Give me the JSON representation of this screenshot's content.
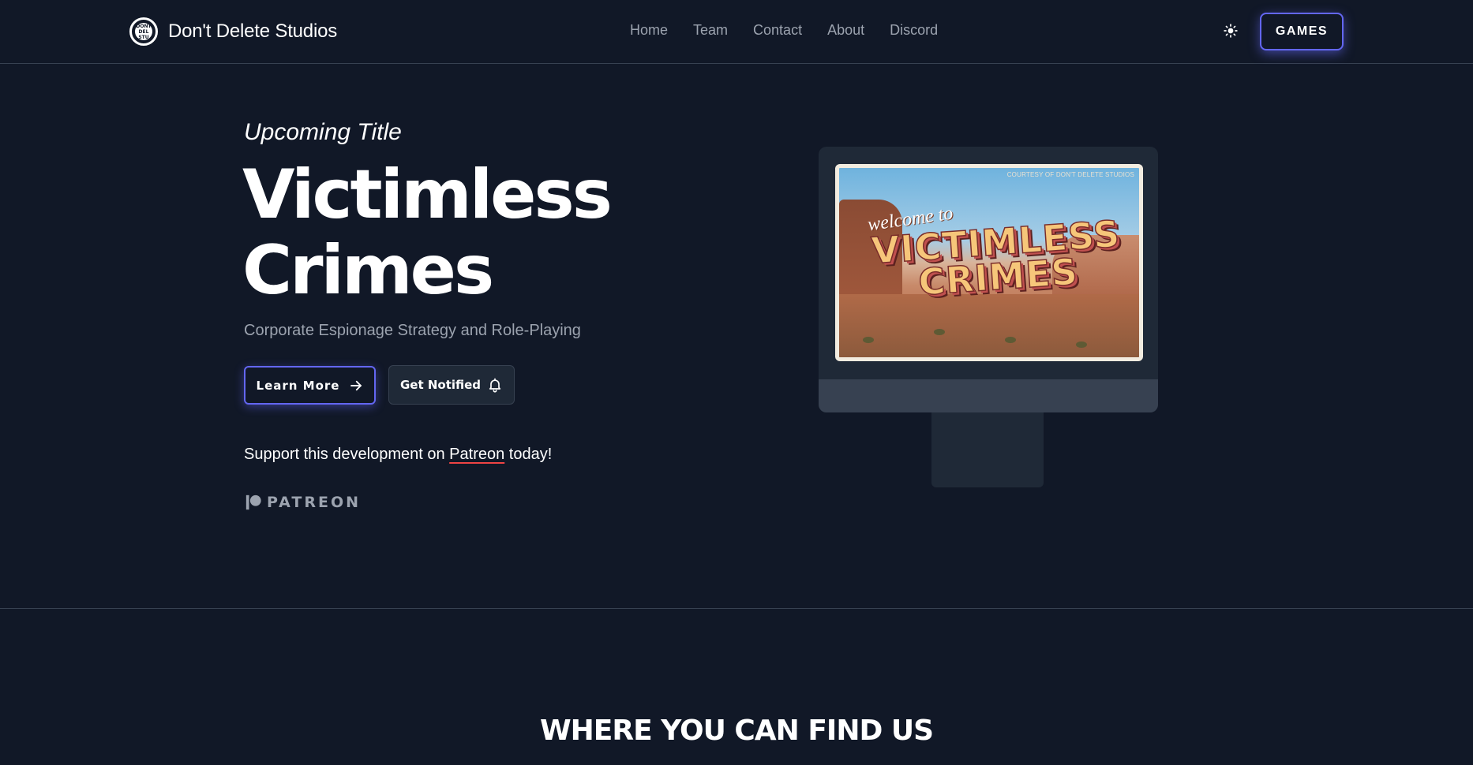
{
  "header": {
    "brand_name": "Don't Delete Studios",
    "logo_text": "DONT DEL STU",
    "nav": [
      "Home",
      "Team",
      "Contact",
      "About",
      "Discord"
    ],
    "theme_icon": "sun-icon",
    "games_label": "GAMES"
  },
  "hero": {
    "eyebrow": "Upcoming Title",
    "title_line1": "Victimless",
    "title_line2": "Crimes",
    "subtitle": "Corporate Espionage Strategy and Role-Playing",
    "learn_more_label": "Learn More",
    "get_notified_label": "Get Notified",
    "support_prefix": "Support this development on ",
    "support_link": "Patreon",
    "support_suffix": " today!",
    "patreon_wordmark": "PATREON"
  },
  "promo_image": {
    "courtesy": "COURTESY OF DON'T DELETE STUDIOS",
    "welcome": "welcome to",
    "title": "VICTIMLESS CRIMES"
  },
  "section": {
    "heading": "WHERE YOU CAN FIND US"
  },
  "colors": {
    "background": "#111827",
    "accent": "#6366f1",
    "muted_text": "#9ca3af",
    "divider": "#374151",
    "patreon_underline": "#ef4444"
  }
}
